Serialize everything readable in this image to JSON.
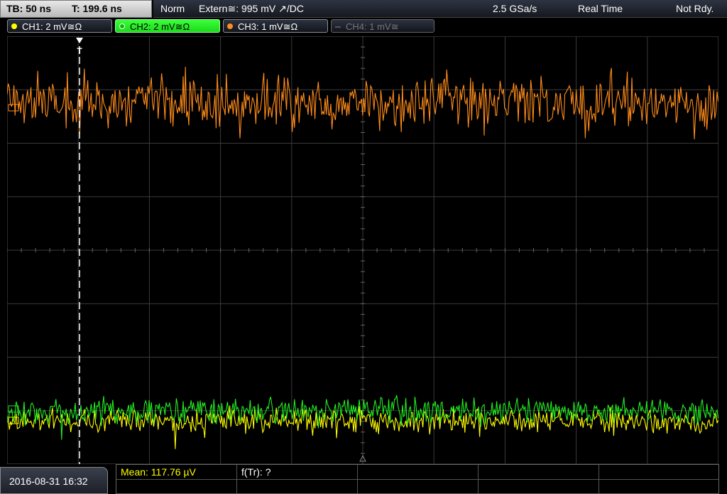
{
  "topbar": {
    "timebase": "TB: 50 ns",
    "trigger_pos": "T: 199.6 ns",
    "trigger_mode": "Norm",
    "trigger_source": "Extern≅: 995 mV ↗/DC",
    "sample_rate": "2.5 GSa/s",
    "acq_mode": "Real Time",
    "status": "Not Rdy."
  },
  "channels": [
    {
      "label": "CH1: 2 mV≅Ω",
      "color": "#ffff00",
      "active": false
    },
    {
      "label": "CH2: 2 mV≅Ω",
      "color": "#00ff00",
      "active": true
    },
    {
      "label": "CH3: 1 mV≅Ω",
      "color": "#ff8c1a",
      "active": false
    },
    {
      "label": "CH4: 1 mV≅",
      "color": "#777777",
      "active": false
    }
  ],
  "trigger_marker": "T",
  "bottom": {
    "datetime": "2016-08-31 16:32",
    "mean": "Mean: 117.76 µV",
    "freq": "f(Tr): ?"
  },
  "colors": {
    "ch1": "#ffff00",
    "ch2": "#22ee22",
    "ch3": "#ff8c1a",
    "grid": "#3a3a3a"
  }
}
